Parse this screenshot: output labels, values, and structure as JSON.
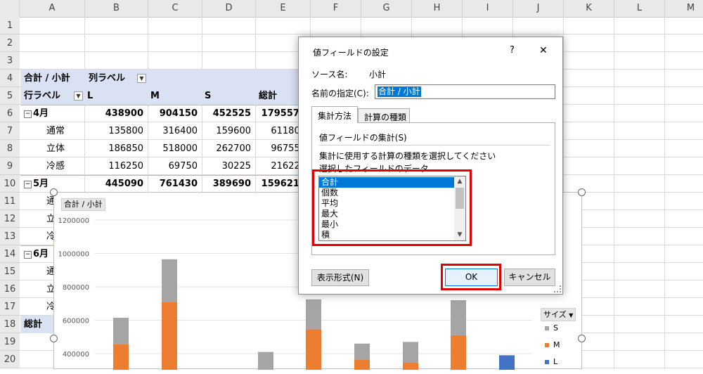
{
  "sheet": {
    "columns": [
      "A",
      "B",
      "C",
      "D",
      "E",
      "F",
      "G",
      "H",
      "I",
      "J",
      "K",
      "L",
      "M"
    ],
    "rows": [
      "1",
      "2",
      "3",
      "4",
      "5",
      "6",
      "7",
      "8",
      "9",
      "10",
      "11",
      "12",
      "13",
      "14",
      "15",
      "16",
      "17",
      "18",
      "19",
      "20"
    ],
    "pivot_header": {
      "value_label": "合計 / 小計",
      "col_label": "列ラベル",
      "row_label": "行ラベル",
      "L": "L",
      "M": "M",
      "S": "S",
      "total": "総計"
    },
    "pivot_rows": [
      {
        "label": "4月",
        "bold": true,
        "group": true,
        "B": "438900",
        "C": "904150",
        "D": "452525",
        "E": "1795575"
      },
      {
        "label": "通常",
        "B": "135800",
        "C": "316400",
        "D": "159600",
        "E": "611800"
      },
      {
        "label": "立体",
        "B": "186850",
        "C": "518000",
        "D": "262700",
        "E": "967550"
      },
      {
        "label": "冷感",
        "B": "116250",
        "C": "69750",
        "D": "30225",
        "E": "216225"
      },
      {
        "label": "5月",
        "bold": true,
        "group": true,
        "B": "445090",
        "C": "761430",
        "D": "389690",
        "E": "1596210"
      },
      {
        "label": "通",
        "B": "",
        "C": "",
        "D": "",
        "E": ""
      },
      {
        "label": "立",
        "B": "",
        "C": "",
        "D": "",
        "E": ""
      },
      {
        "label": "冷",
        "B": "",
        "C": "",
        "D": "",
        "E": ""
      },
      {
        "label": "6月",
        "bold": true,
        "group": true,
        "B": "",
        "C": "",
        "D": "",
        "E": ""
      },
      {
        "label": "通",
        "B": "",
        "C": "",
        "D": "",
        "E": ""
      },
      {
        "label": "立",
        "B": "",
        "C": "",
        "D": "",
        "E": ""
      },
      {
        "label": "冷",
        "B": "",
        "C": "",
        "D": "",
        "E": ""
      },
      {
        "label": "総計",
        "bold": true,
        "total": true,
        "B": "",
        "C": "",
        "D": "",
        "E": ""
      }
    ]
  },
  "chart": {
    "value_button": "合計 / 小計",
    "legend_title": "サイズ",
    "legend": [
      "S",
      "M",
      "L"
    ],
    "colors": {
      "S": "#a5a5a5",
      "M": "#ed7d31",
      "L": "#4472c4"
    }
  },
  "chart_data": {
    "type": "bar",
    "stacked": true,
    "ylim": [
      0,
      1200000
    ],
    "yticks": [
      "1200000",
      "1000000",
      "800000",
      "600000",
      "400000"
    ],
    "visible_min": 380000,
    "series": [
      {
        "name": "L",
        "values": [
          0,
          0,
          0,
          0,
          0,
          0,
          0,
          0,
          390000
        ]
      },
      {
        "name": "M",
        "values": [
          455000,
          710000,
          0,
          545000,
          365000,
          345000,
          510000,
          225000,
          0
        ]
      },
      {
        "name": "S",
        "values": [
          160000,
          255000,
          410000,
          180000,
          95000,
          125000,
          210000,
          0,
          0
        ]
      }
    ],
    "totals_hint": [
      615000,
      965000,
      410000,
      725000,
      460000,
      470000,
      720000,
      0,
      0
    ]
  },
  "dialog": {
    "title": "値フィールドの設定",
    "help": "?",
    "close": "✕",
    "source_label": "ソース名:",
    "source_value": "小計",
    "name_label": "名前の指定(C):",
    "name_value": "合計 / 小計",
    "tabs": [
      "集計方法",
      "計算の種類"
    ],
    "section": "値フィールドの集計(S)",
    "desc1": "集計に使用する計算の種類を選択してください",
    "desc2": "選択したフィールドのデータ",
    "list": [
      "合計",
      "個数",
      "平均",
      "最大",
      "最小",
      "積"
    ],
    "selected": "合計",
    "format_button": "表示形式(N)",
    "ok": "OK",
    "cancel": "キャンセル"
  }
}
